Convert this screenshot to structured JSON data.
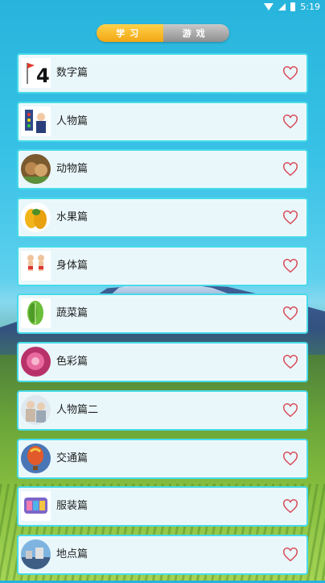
{
  "tabs": [
    {
      "label": "学习",
      "active": true
    },
    {
      "label": "游戏",
      "active": false
    }
  ],
  "status": {
    "time": "5:19"
  },
  "items": [
    {
      "label": "数字篇",
      "thumb": "number-4-icon"
    },
    {
      "label": "人物篇",
      "thumb": "people-icon"
    },
    {
      "label": "动物篇",
      "thumb": "animals-icon"
    },
    {
      "label": "水果篇",
      "thumb": "fruit-icon"
    },
    {
      "label": "身体篇",
      "thumb": "body-icon"
    },
    {
      "label": "蔬菜篇",
      "thumb": "vegetable-icon"
    },
    {
      "label": "色彩篇",
      "thumb": "color-flower-icon"
    },
    {
      "label": "人物篇二",
      "thumb": "people2-icon"
    },
    {
      "label": "交通篇",
      "thumb": "balloon-icon"
    },
    {
      "label": "服装篇",
      "thumb": "clothes-icon"
    },
    {
      "label": "地点篇",
      "thumb": "place-icon"
    }
  ],
  "colors": {
    "accent": "#47dbe9",
    "heart": "#d94a55",
    "tab_active": "#f2a613"
  }
}
